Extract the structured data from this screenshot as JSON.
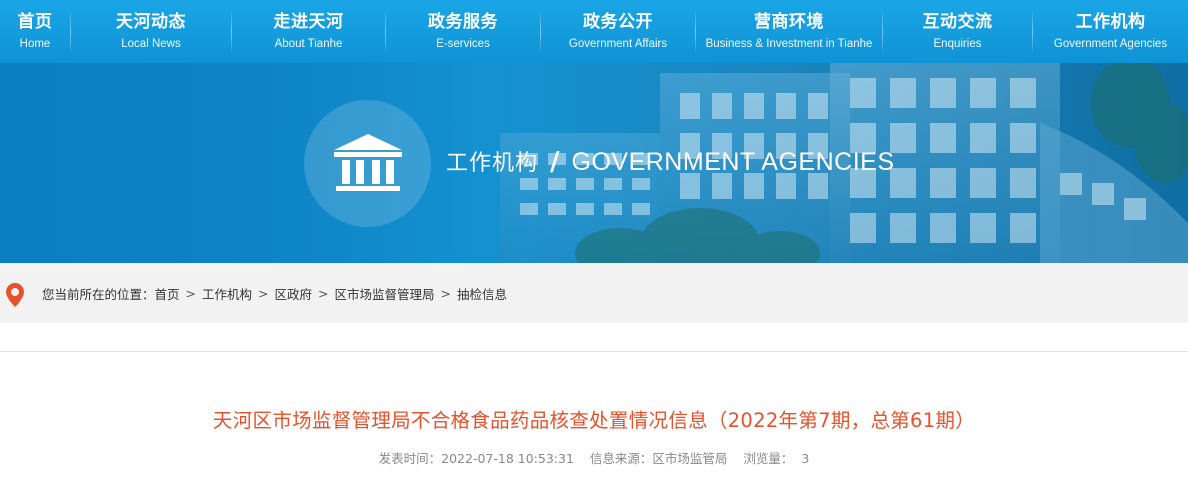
{
  "nav": {
    "items": [
      {
        "cn": "首页",
        "en": "Home"
      },
      {
        "cn": "天河动态",
        "en": "Local News"
      },
      {
        "cn": "走进天河",
        "en": "About Tianhe"
      },
      {
        "cn": "政务服务",
        "en": "E-services"
      },
      {
        "cn": "政务公开",
        "en": "Government Affairs"
      },
      {
        "cn": "营商环境",
        "en": "Business & Investment in Tianhe"
      },
      {
        "cn": "互动交流",
        "en": "Enquiries"
      },
      {
        "cn": "工作机构",
        "en": "Government Agencies"
      }
    ]
  },
  "banner": {
    "title_cn": "工作机构",
    "slash": "/",
    "title_en": "GOVERNMENT AGENCIES",
    "icon": "government-building-icon"
  },
  "breadcrumb": {
    "prefix": "您当前所在的位置：",
    "items": [
      "首页",
      "工作机构",
      "区政府",
      "区市场监督管理局",
      "抽检信息"
    ],
    "separator": ">"
  },
  "article": {
    "title": "天河区市场监督管理局不合格食品药品核查处置情况信息（2022年第7期，总第61期）",
    "publish_label": "发表时间：2022-07-18 10:53:31",
    "source_label": "信息来源：区市场监管局",
    "views_label": "浏览量：",
    "views": "3"
  },
  "colors": {
    "nav_bg": "#1aa6e6",
    "title": "#e8512b",
    "pin": "#e8512b"
  }
}
